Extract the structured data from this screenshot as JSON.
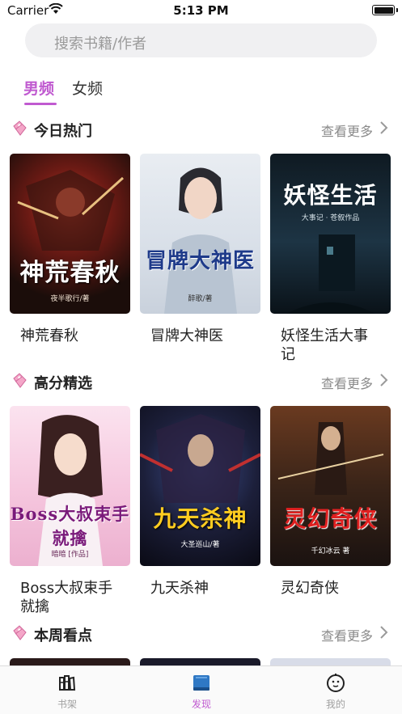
{
  "status_bar": {
    "carrier": "Carrier",
    "time": "5:13 PM"
  },
  "search": {
    "placeholder": "搜索书籍/作者"
  },
  "tabs": [
    {
      "label": "男频",
      "active": true
    },
    {
      "label": "女频",
      "active": false
    }
  ],
  "sections": [
    {
      "title": "今日热门",
      "more": "查看更多",
      "books": [
        {
          "name": "神荒春秋",
          "cover_title": "神荒春秋",
          "cover_sub": "夜半歌行/著"
        },
        {
          "name": "冒牌大神医",
          "cover_title": "冒牌大神医",
          "cover_sub": "醉歌/著"
        },
        {
          "name": "妖怪生活大事记",
          "cover_title": "妖怪生活",
          "cover_sub": "大事记 · 苍叙作品"
        }
      ]
    },
    {
      "title": "高分精选",
      "more": "查看更多",
      "books": [
        {
          "name": "Boss大叔束手就擒",
          "cover_title": "Boss大叔束手就擒",
          "cover_sub": "暗暗 [作品]"
        },
        {
          "name": "九天杀神",
          "cover_title": "九天杀神",
          "cover_sub": "大圣巡山/著"
        },
        {
          "name": "灵幻奇侠",
          "cover_title": "灵幻奇侠",
          "cover_sub": "千幻冰云 著"
        }
      ]
    },
    {
      "title": "本周看点",
      "more": "查看更多",
      "books": []
    }
  ],
  "tabbar": [
    {
      "label": "书架",
      "icon": "bookshelf-icon",
      "active": false
    },
    {
      "label": "发现",
      "icon": "discover-book-icon",
      "active": true
    },
    {
      "label": "我的",
      "icon": "profile-face-icon",
      "active": false
    }
  ],
  "colors": {
    "accent": "#c05ad0",
    "muted": "#8a8a8a",
    "search_bg": "#f0f0f2"
  }
}
